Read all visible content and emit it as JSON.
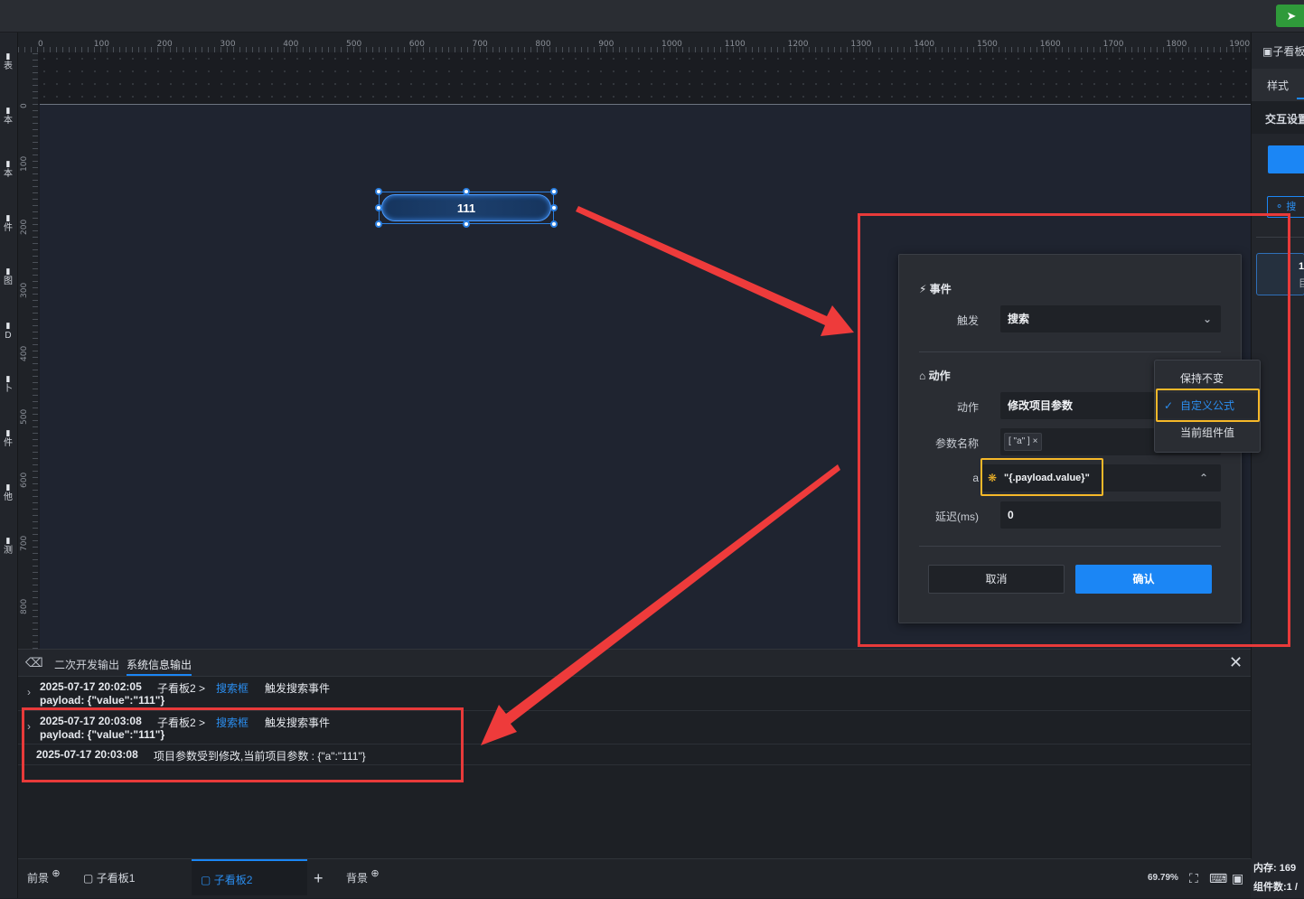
{
  "toolbar": {
    "send_icon": "send-icon",
    "left_items": [
      "表",
      "本",
      "本",
      "件",
      "图",
      "D",
      "卜",
      "件",
      "他",
      "测"
    ]
  },
  "ruler": {
    "h_labels": [
      "0",
      "100",
      "200",
      "300",
      "400",
      "500",
      "600",
      "700",
      "800",
      "900",
      "1000",
      "1100",
      "1200",
      "1300",
      "1400",
      "1500",
      "1600",
      "1700",
      "1800",
      "1900"
    ],
    "v_labels": [
      "0",
      "100",
      "200",
      "300",
      "400",
      "500",
      "600",
      "700",
      "800"
    ]
  },
  "canvas": {
    "search_box_text": "111"
  },
  "right_panel": {
    "header": "子看板",
    "tab_style": "样式",
    "section": "交互设置",
    "search_hint": "搜",
    "card_line1": "1.",
    "card_line2": "目"
  },
  "modal": {
    "event_section": "事件",
    "trigger_label": "触发",
    "trigger_value": "搜索",
    "action_section": "动作",
    "action_label": "动作",
    "action_value": "修改项目参数",
    "param_label": "参数名称",
    "param_tag": "[ \"a\" ]",
    "param_a_label": "a",
    "param_a_value": "\"{.payload.value}\"",
    "delay_label": "延迟(ms)",
    "delay_value": "0",
    "cancel": "取消",
    "confirm": "确认"
  },
  "dropdown": {
    "options": [
      "保持不变",
      "自定义公式",
      "当前组件值"
    ],
    "selected": "自定义公式"
  },
  "log": {
    "tab_dev": "二次开发输出",
    "tab_sys": "系统信息输出",
    "rows": [
      {
        "time": "2025-07-17 20:02:05",
        "path": "子看板2 >",
        "target": "搜索框",
        "event": "触发搜索事件",
        "payload": "payload: {\"value\":\"111\"}"
      },
      {
        "time": "2025-07-17 20:03:08",
        "path": "子看板2 >",
        "target": "搜索框",
        "event": "触发搜索事件",
        "payload": "payload: {\"value\":\"111\"}"
      }
    ],
    "message_time": "2025-07-17 20:03:08",
    "message": "项目参数受到修改,当前项目参数 : {\"a\":\"111\"}"
  },
  "bottom": {
    "tab_front": "前景",
    "tab_board1": "子看板1",
    "tab_board2": "子看板2",
    "tab_back": "背景",
    "zoom": "69.79%",
    "memory": "内存: 169",
    "components": "组件数:1 /"
  },
  "colors": {
    "accent": "#1b86f5",
    "highlight_yellow": "#f6b829",
    "highlight_red": "#e83a3a"
  }
}
